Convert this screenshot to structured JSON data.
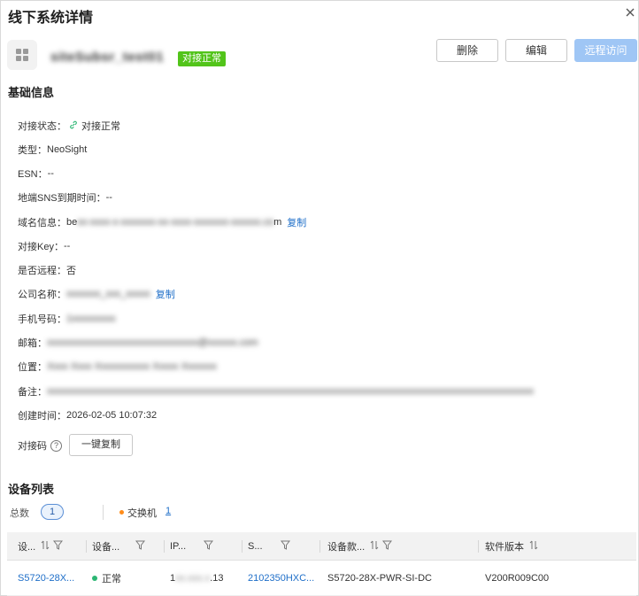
{
  "dialog": {
    "title": "线下系统详情"
  },
  "header": {
    "system_name": "siteSubsr_test01",
    "status_tag": "对接正常",
    "buttons": {
      "delete": "删除",
      "edit": "编辑",
      "remote": "远程访问"
    }
  },
  "basic_info": {
    "section_title": "基础信息",
    "rows": {
      "status": {
        "label": "对接状态：",
        "value": "对接正常"
      },
      "type": {
        "label": "类型：",
        "value": "NeoSight"
      },
      "esn": {
        "label": "ESN：",
        "value": "--"
      },
      "sns_expiry": {
        "label": "地端SNS到期时间：",
        "value": "--"
      },
      "domain": {
        "label": "域名信息：",
        "prefix": "be",
        "hidden": "xx-xxxx-x-xxxxxxx-xx-xxxx-xxxxxxx-xxxxxx.co",
        "suffix": "m",
        "copy": "复制"
      },
      "key": {
        "label": "对接Key：",
        "value": "--"
      },
      "remote": {
        "label": "是否远程：",
        "value": "否"
      },
      "company": {
        "label": "公司名称：",
        "hidden": "xxxxxxx_xxx_xxxxx",
        "copy": "复制"
      },
      "phone": {
        "label": "手机号码：",
        "hidden": "1xxxxxxxxx"
      },
      "email": {
        "label": "邮箱：",
        "hidden": "xxxxxxxxxxxxxxxxxxxxxxxxxxxxxxx@xxxxxx.com"
      },
      "location": {
        "label": "位置：",
        "hidden": "Xxxx Xxxx Xxxxxxxxxxx Xxxxx Xxxxxxx"
      },
      "remark": {
        "label": "备注：",
        "hidden": "xxxxxxxxxxxxxxxxxxxxxxxxxxxxxxxxxxxxxxxxxxxxxxxxxxxxxxxxxxxxxxxxxxxxxxxxxxxxxxxxxxxxxxxxxxxxxxxxxxxx"
      },
      "created": {
        "label": "创建时间：",
        "value": "2026-02-05 10:07:32"
      },
      "code": {
        "label": "对接码",
        "help": "?",
        "button": "一键复制"
      }
    }
  },
  "device_list": {
    "section_title": "设备列表",
    "total_label": "总数",
    "total_count": "1",
    "type_label": "交换机",
    "type_count": "1",
    "columns": [
      "设...",
      "设备...",
      "IP...",
      "S...",
      "设备款...",
      "软件版本"
    ],
    "rows": [
      {
        "device": "S5720-28X...",
        "status": "正常",
        "ip_prefix": "1",
        "ip_hidden": "xx.xxx.x",
        "ip_suffix": ".13",
        "sn": "2102350HXC...",
        "model": "S5720-28X-PWR-SI-DC",
        "version": "V200R009C00"
      }
    ]
  },
  "colors": {
    "accent": "#1e6ec8",
    "status_green": "#52c41a",
    "online_dot": "#2bb673",
    "switch_dot": "#ff8c1a",
    "remote_btn": "#9fc6f5"
  },
  "icons": {
    "close": "close-icon",
    "system": "grid-icon",
    "link": "link-icon",
    "help": "help-icon",
    "sort": "sort-icon",
    "filter": "filter-icon"
  }
}
